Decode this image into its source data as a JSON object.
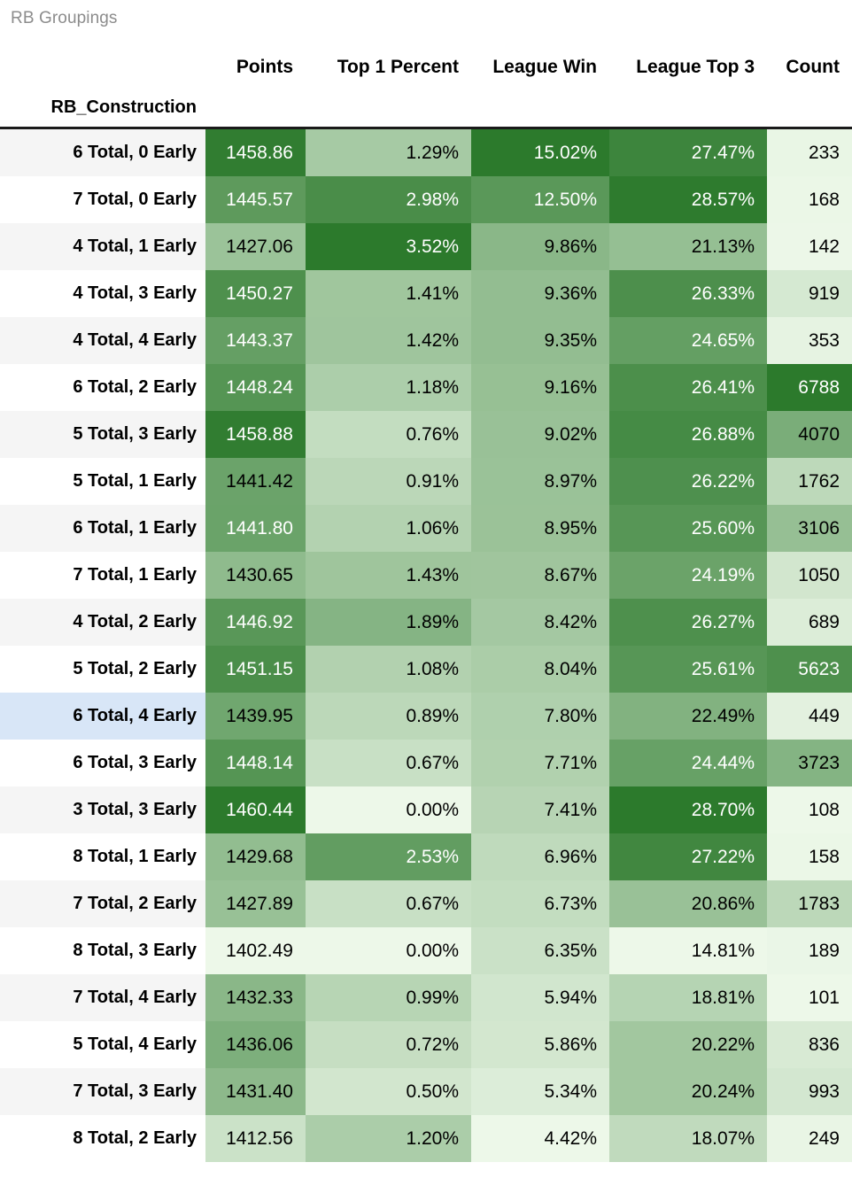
{
  "caption": "RB Groupings",
  "index_name": "RB_Construction",
  "columns": [
    "Points",
    "Top 1 Percent",
    "League Win",
    "League Top 3",
    "Count"
  ],
  "colors": {
    "heat_light": "#edf8e9",
    "heat_dark": "#2c7a2c",
    "row_odd_bg": "#f5f5f5",
    "row_even_bg": "#ffffff",
    "highlight_bg": "#d8e6f7",
    "caption_color": "#8c8c8c",
    "rule_color": "#1a1a1a"
  },
  "highlight_row_index": 12,
  "rows": [
    {
      "label": "6 Total, 0 Early",
      "points": "1458.86",
      "top1": "1.29%",
      "league_win": "15.02%",
      "league_top3": "27.47%",
      "count": "233"
    },
    {
      "label": "7 Total, 0 Early",
      "points": "1445.57",
      "top1": "2.98%",
      "league_win": "12.50%",
      "league_top3": "28.57%",
      "count": "168"
    },
    {
      "label": "4 Total, 1 Early",
      "points": "1427.06",
      "top1": "3.52%",
      "league_win": "9.86%",
      "league_top3": "21.13%",
      "count": "142"
    },
    {
      "label": "4 Total, 3 Early",
      "points": "1450.27",
      "top1": "1.41%",
      "league_win": "9.36%",
      "league_top3": "26.33%",
      "count": "919"
    },
    {
      "label": "4 Total, 4 Early",
      "points": "1443.37",
      "top1": "1.42%",
      "league_win": "9.35%",
      "league_top3": "24.65%",
      "count": "353"
    },
    {
      "label": "6 Total, 2 Early",
      "points": "1448.24",
      "top1": "1.18%",
      "league_win": "9.16%",
      "league_top3": "26.41%",
      "count": "6788"
    },
    {
      "label": "5 Total, 3 Early",
      "points": "1458.88",
      "top1": "0.76%",
      "league_win": "9.02%",
      "league_top3": "26.88%",
      "count": "4070"
    },
    {
      "label": "5 Total, 1 Early",
      "points": "1441.42",
      "top1": "0.91%",
      "league_win": "8.97%",
      "league_top3": "26.22%",
      "count": "1762"
    },
    {
      "label": "6 Total, 1 Early",
      "points": "1441.80",
      "top1": "1.06%",
      "league_win": "8.95%",
      "league_top3": "25.60%",
      "count": "3106"
    },
    {
      "label": "7 Total, 1 Early",
      "points": "1430.65",
      "top1": "1.43%",
      "league_win": "8.67%",
      "league_top3": "24.19%",
      "count": "1050"
    },
    {
      "label": "4 Total, 2 Early",
      "points": "1446.92",
      "top1": "1.89%",
      "league_win": "8.42%",
      "league_top3": "26.27%",
      "count": "689"
    },
    {
      "label": "5 Total, 2 Early",
      "points": "1451.15",
      "top1": "1.08%",
      "league_win": "8.04%",
      "league_top3": "25.61%",
      "count": "5623"
    },
    {
      "label": "6 Total, 4 Early",
      "points": "1439.95",
      "top1": "0.89%",
      "league_win": "7.80%",
      "league_top3": "22.49%",
      "count": "449"
    },
    {
      "label": "6 Total, 3 Early",
      "points": "1448.14",
      "top1": "0.67%",
      "league_win": "7.71%",
      "league_top3": "24.44%",
      "count": "3723"
    },
    {
      "label": "3 Total, 3 Early",
      "points": "1460.44",
      "top1": "0.00%",
      "league_win": "7.41%",
      "league_top3": "28.70%",
      "count": "108"
    },
    {
      "label": "8 Total, 1 Early",
      "points": "1429.68",
      "top1": "2.53%",
      "league_win": "6.96%",
      "league_top3": "27.22%",
      "count": "158"
    },
    {
      "label": "7 Total, 2 Early",
      "points": "1427.89",
      "top1": "0.67%",
      "league_win": "6.73%",
      "league_top3": "20.86%",
      "count": "1783"
    },
    {
      "label": "8 Total, 3 Early",
      "points": "1402.49",
      "top1": "0.00%",
      "league_win": "6.35%",
      "league_top3": "14.81%",
      "count": "189"
    },
    {
      "label": "7 Total, 4 Early",
      "points": "1432.33",
      "top1": "0.99%",
      "league_win": "5.94%",
      "league_top3": "18.81%",
      "count": "101"
    },
    {
      "label": "5 Total, 4 Early",
      "points": "1436.06",
      "top1": "0.72%",
      "league_win": "5.86%",
      "league_top3": "20.22%",
      "count": "836"
    },
    {
      "label": "7 Total, 3 Early",
      "points": "1431.40",
      "top1": "0.50%",
      "league_win": "5.34%",
      "league_top3": "20.24%",
      "count": "993"
    },
    {
      "label": "8 Total, 2 Early",
      "points": "1412.56",
      "top1": "1.20%",
      "league_win": "4.42%",
      "league_top3": "18.07%",
      "count": "249"
    }
  ],
  "chart_data": {
    "type": "heatmap",
    "title": "RB Groupings",
    "index_label": "RB_Construction",
    "categories": [
      "6 Total, 0 Early",
      "7 Total, 0 Early",
      "4 Total, 1 Early",
      "4 Total, 3 Early",
      "4 Total, 4 Early",
      "6 Total, 2 Early",
      "5 Total, 3 Early",
      "5 Total, 1 Early",
      "6 Total, 1 Early",
      "7 Total, 1 Early",
      "4 Total, 2 Early",
      "5 Total, 2 Early",
      "6 Total, 4 Early",
      "6 Total, 3 Early",
      "3 Total, 3 Early",
      "8 Total, 1 Early",
      "7 Total, 2 Early",
      "8 Total, 3 Early",
      "7 Total, 4 Early",
      "5 Total, 4 Early",
      "7 Total, 3 Early",
      "8 Total, 2 Early"
    ],
    "series": [
      {
        "name": "Points",
        "values": [
          1458.86,
          1445.57,
          1427.06,
          1450.27,
          1443.37,
          1448.24,
          1458.88,
          1441.42,
          1441.8,
          1430.65,
          1446.92,
          1451.15,
          1439.95,
          1448.14,
          1460.44,
          1429.68,
          1427.89,
          1402.49,
          1432.33,
          1436.06,
          1431.4,
          1412.56
        ]
      },
      {
        "name": "Top 1 Percent",
        "values": [
          1.29,
          2.98,
          3.52,
          1.41,
          1.42,
          1.18,
          0.76,
          0.91,
          1.06,
          1.43,
          1.89,
          1.08,
          0.89,
          0.67,
          0.0,
          2.53,
          0.67,
          0.0,
          0.99,
          0.72,
          0.5,
          1.2
        ]
      },
      {
        "name": "League Win",
        "values": [
          15.02,
          12.5,
          9.86,
          9.36,
          9.35,
          9.16,
          9.02,
          8.97,
          8.95,
          8.67,
          8.42,
          8.04,
          7.8,
          7.71,
          7.41,
          6.96,
          6.73,
          6.35,
          5.94,
          5.86,
          5.34,
          4.42
        ]
      },
      {
        "name": "League Top 3",
        "values": [
          27.47,
          28.57,
          21.13,
          26.33,
          24.65,
          26.41,
          26.88,
          26.22,
          25.6,
          24.19,
          26.27,
          25.61,
          22.49,
          24.44,
          28.7,
          27.22,
          20.86,
          14.81,
          18.81,
          20.22,
          20.24,
          18.07
        ]
      },
      {
        "name": "Count",
        "values": [
          233,
          168,
          142,
          919,
          353,
          6788,
          4070,
          1762,
          3106,
          1050,
          689,
          5623,
          449,
          3723,
          108,
          158,
          1783,
          189,
          101,
          836,
          993,
          249
        ]
      }
    ],
    "colormap": "Greens",
    "sorted_by": "League Win",
    "sort_order": "descending"
  }
}
